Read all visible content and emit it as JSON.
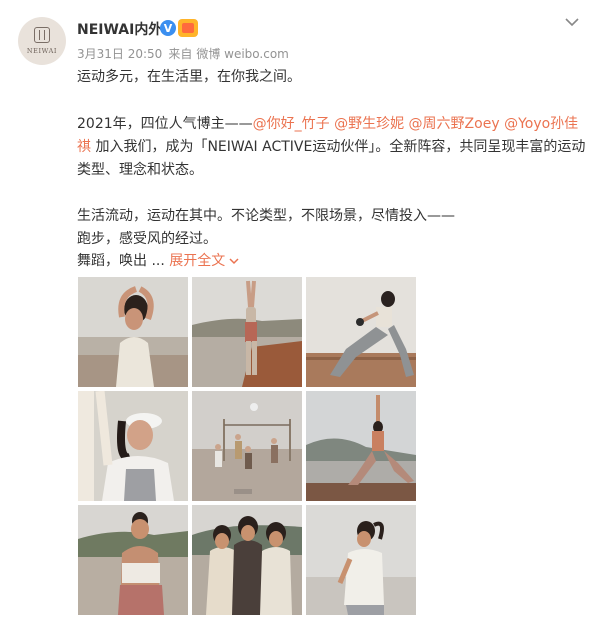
{
  "header": {
    "username": "NEIWAI内外",
    "avatar_brand": "NEIWAI",
    "verified_mark": "V",
    "date": "3月31日 20:50",
    "source_prefix": "来自",
    "source": "微博 weibo.com"
  },
  "post": {
    "line1": "运动多元，在生活里，在你我之间。",
    "p2_prefix": "2021年，四位人气博主——",
    "mentions": [
      "@你好_竹子",
      "@野生珍妮",
      "@周六野Zoey",
      "@Yoyo孙佳祺"
    ],
    "p2_suffix": "加入我们，成为「NEIWAI ACTIVE运动伙伴」。全新阵容，共同呈现丰富的运动类型、理念和状态。",
    "p3_line1": "生活流动，运动在其中。不论类型，不限场景，尽情投入——",
    "p3_line2": "跑步，感受风的经过。",
    "p3_line3": "舞蹈，唤出 ...",
    "expand_label": "展开全文"
  },
  "images": [
    {
      "name": "photo-1",
      "scene": "beach-stretch"
    },
    {
      "name": "photo-2",
      "scene": "coast-standing"
    },
    {
      "name": "photo-3",
      "scene": "ledge-pose"
    },
    {
      "name": "photo-4",
      "scene": "cap-portrait"
    },
    {
      "name": "photo-5",
      "scene": "beach-group"
    },
    {
      "name": "photo-6",
      "scene": "yoga-lunge"
    },
    {
      "name": "photo-7",
      "scene": "back-portrait"
    },
    {
      "name": "photo-8",
      "scene": "trio"
    },
    {
      "name": "photo-9",
      "scene": "side-profile"
    }
  ]
}
